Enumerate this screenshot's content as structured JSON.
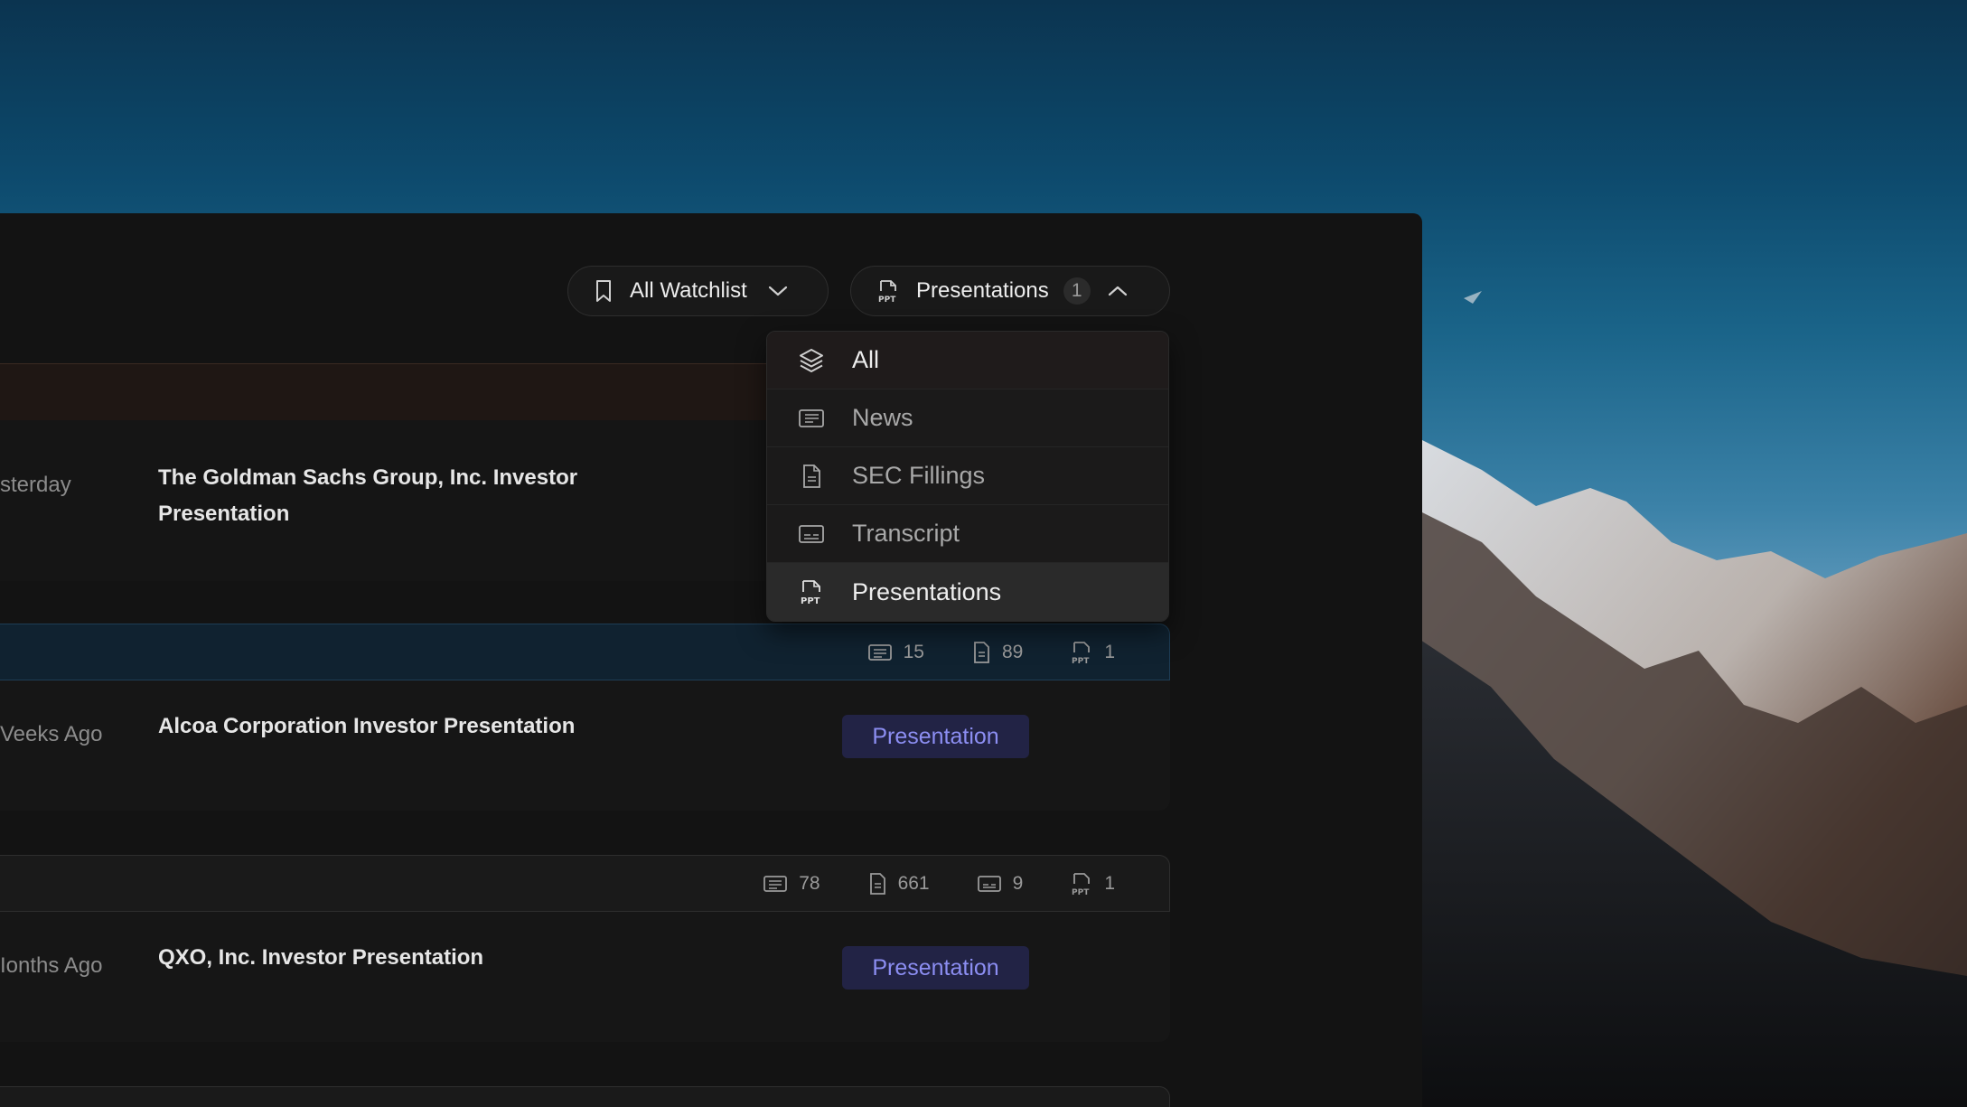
{
  "toolbar": {
    "watchlist_label": "All Watchlist",
    "type_filter_label": "Presentations",
    "type_filter_count": "1"
  },
  "dropdown": {
    "items": [
      {
        "label": "All",
        "icon": "layers-icon"
      },
      {
        "label": "News",
        "icon": "newspaper-icon"
      },
      {
        "label": "SEC Fillings",
        "icon": "document-icon"
      },
      {
        "label": "Transcript",
        "icon": "subtitles-icon"
      },
      {
        "label": "Presentations",
        "icon": "ppt-icon"
      }
    ]
  },
  "rows": [
    {
      "time": "sterday",
      "title": "The Goldman Sachs Group, Inc. Investor Presentation"
    },
    {
      "header_counts": {
        "news": "15",
        "filings": "89",
        "presentations": "1"
      },
      "time": "Veeks Ago",
      "title": "Alcoa Corporation Investor Presentation",
      "tag": "Presentation"
    },
    {
      "header_counts": {
        "news": "78",
        "filings": "661",
        "transcripts": "9",
        "presentations": "1"
      },
      "time": "Ionths Ago",
      "title": "QXO, Inc. Investor Presentation",
      "tag": "Presentation"
    }
  ],
  "colors": {
    "accent_tag_bg": "#222345",
    "accent_tag_text": "#8c8ef2",
    "window_bg": "#131313"
  }
}
